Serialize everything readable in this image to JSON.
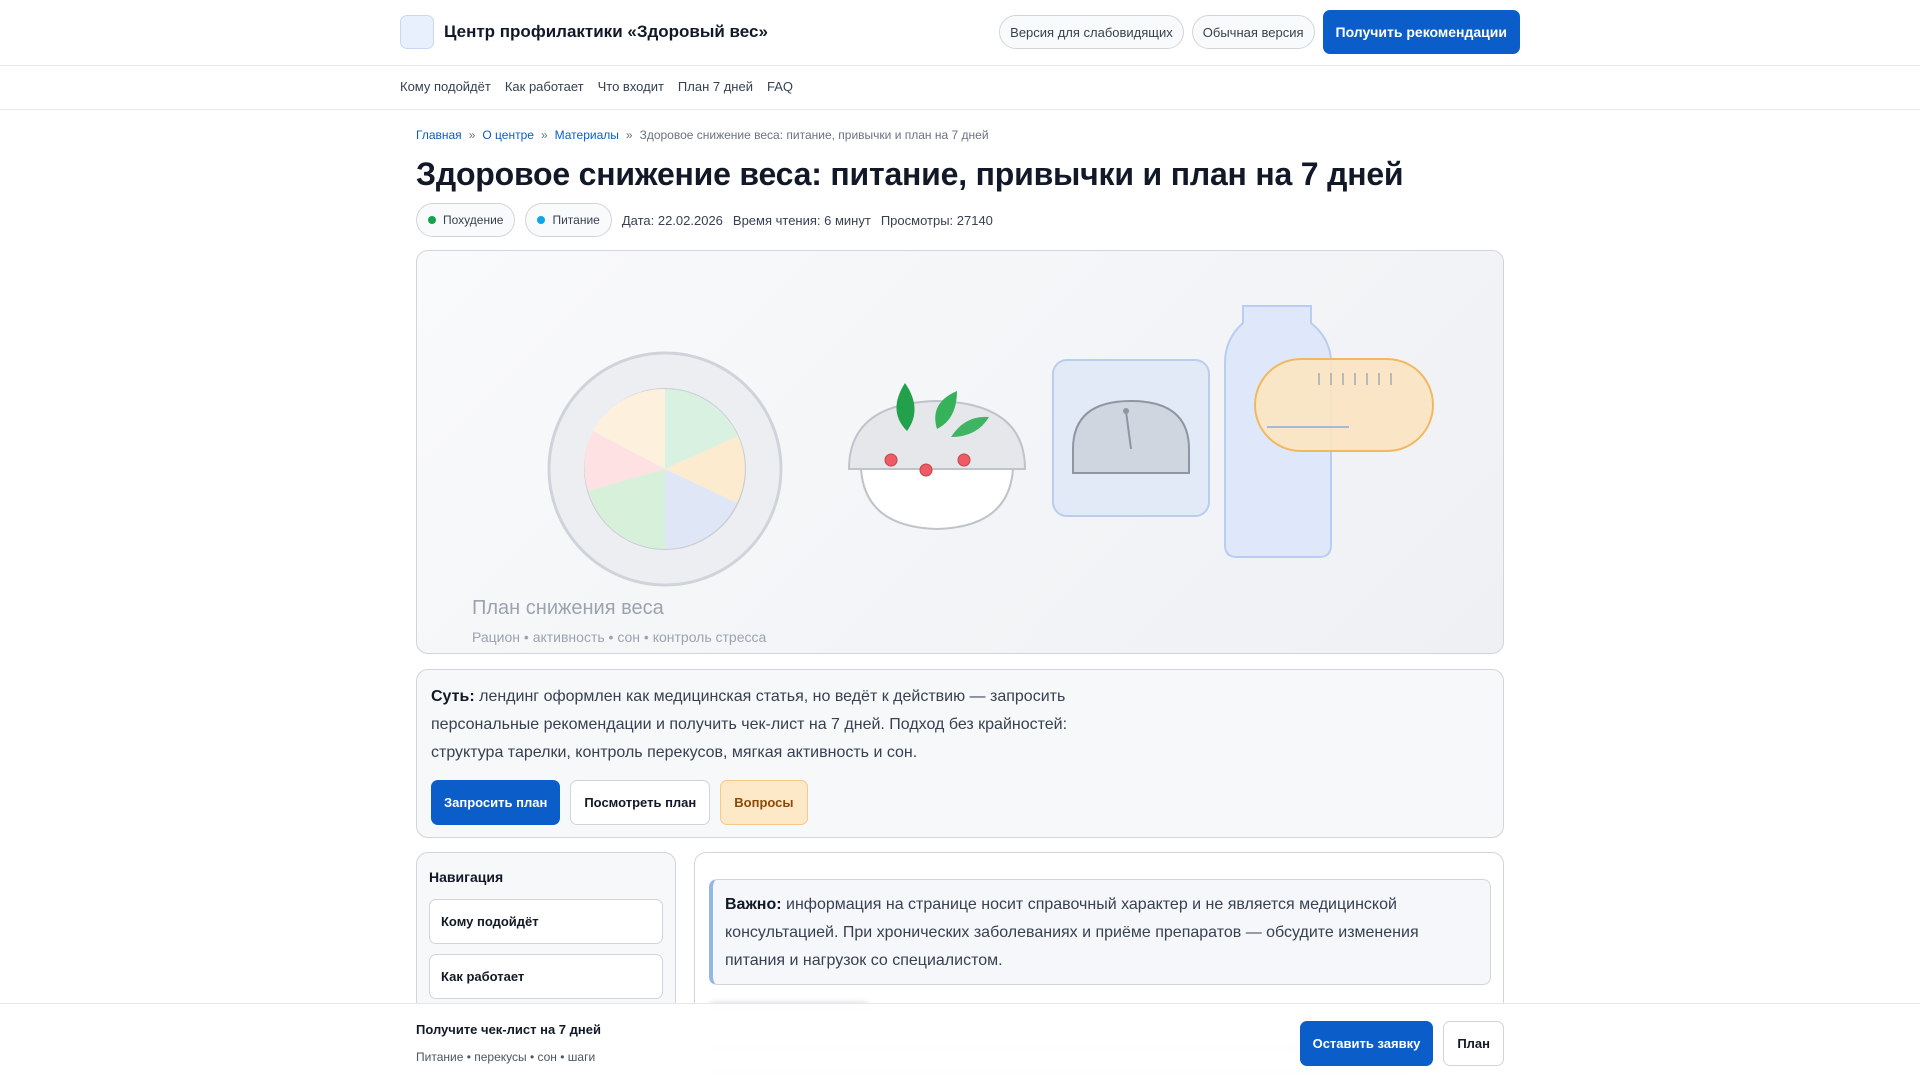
{
  "header": {
    "brand": "Центр профилактики «Здоровый вес»",
    "low_vision": "Версия для слабовидящих",
    "normal": "Обычная версия",
    "cta": "Получить рекомендации"
  },
  "subnav": [
    "Кому подойдёт",
    "Как работает",
    "Что входит",
    "План 7 дней",
    "FAQ"
  ],
  "breadcrumb": {
    "items": [
      "Главная",
      "О центре",
      "Материалы"
    ],
    "current": "Здоровое снижение веса: питание, привычки и план на 7 дней",
    "separator": "»"
  },
  "article": {
    "title": "Здоровое снижение веса: питание, привычки и план на 7 дней",
    "tags": [
      {
        "label": "Похудение",
        "color": "#16a34a"
      },
      {
        "label": "Питание",
        "color": "#0ea5e9"
      }
    ],
    "date": "Дата: 22.02.2026",
    "reading_time": "Время чтения: 6 минут",
    "views": "Просмотры: 27140"
  },
  "hero": {
    "title": "План снижения веса",
    "subtitle": "Рацион • активность • сон • контроль стресса"
  },
  "summary": {
    "lead": "Суть:",
    "text": " лендинг оформлен как медицинская статья, но ведёт к действию — запросить персональные рекомендации и получить чек-лист на 7 дней. Подход без крайностей: структура тарелки, контроль перекусов, мягкая активность и сон.",
    "actions": [
      "Запросить план",
      "Посмотреть план",
      "Вопросы"
    ]
  },
  "sidenav": {
    "title": "Навигация",
    "items": [
      "Кому подойдёт",
      "Как работает"
    ]
  },
  "notice": {
    "lead": "Важно:",
    "text": " информация на странице носит справочный характер и не является медицинской консультацией. При хронических заболеваниях и приёме препаратов — обсудите изменения питания и нагрузок со специалистом."
  },
  "sticky": {
    "title": "Получите чек-лист на 7 дней",
    "subtitle": "Питание • перекусы • сон • шаги",
    "apply": "Оставить заявку",
    "plan": "План"
  }
}
